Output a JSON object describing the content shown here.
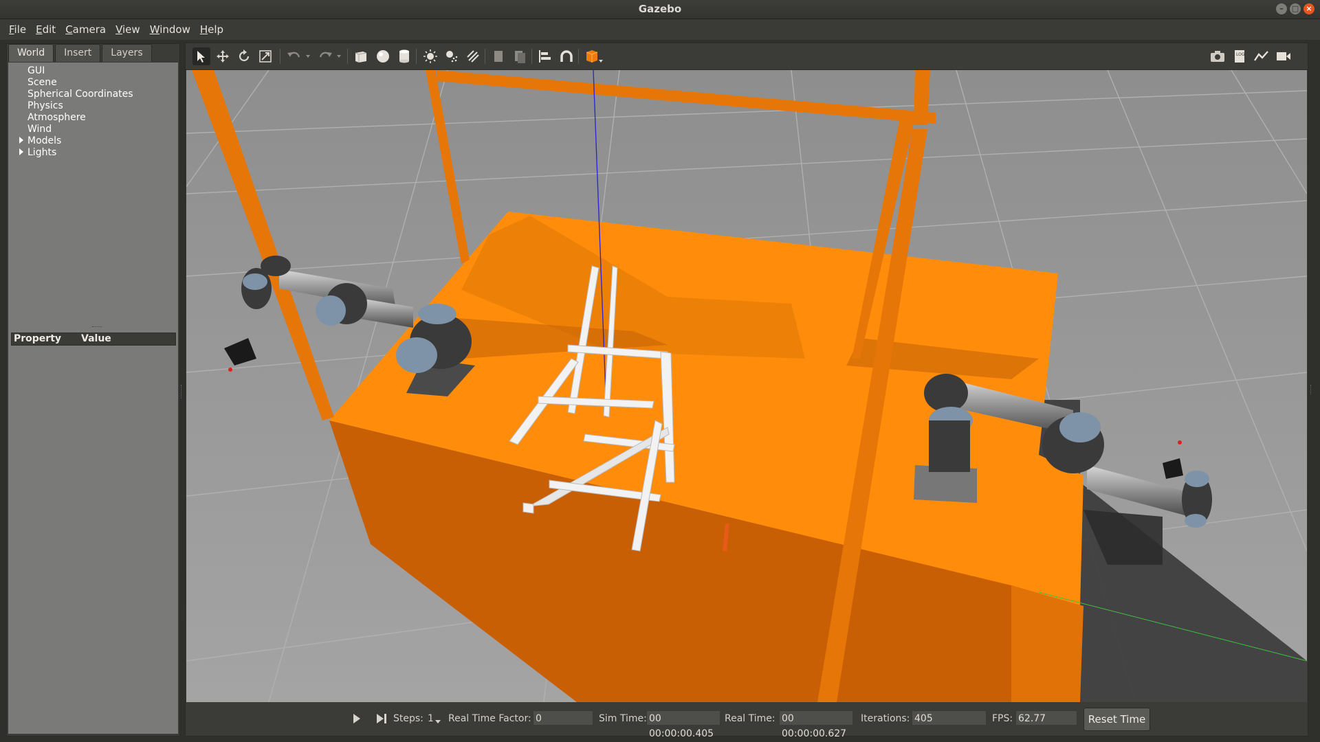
{
  "window": {
    "title": "Gazebo"
  },
  "menu": [
    {
      "key": "F",
      "rest": "ile"
    },
    {
      "key": "E",
      "rest": "dit"
    },
    {
      "key": "C",
      "rest": "amera"
    },
    {
      "key": "V",
      "rest": "iew"
    },
    {
      "key": "W",
      "rest": "indow"
    },
    {
      "key": "H",
      "rest": "elp"
    }
  ],
  "tabs": [
    "World",
    "Insert",
    "Layers"
  ],
  "tree": [
    "GUI",
    "Scene",
    "Spherical Coordinates",
    "Physics",
    "Atmosphere",
    "Wind",
    "Models",
    "Lights"
  ],
  "properties": {
    "col1": "Property",
    "col2": "Value"
  },
  "bottom": {
    "steps_label": "Steps:",
    "steps_value": "1",
    "rtf_label": "Real Time Factor:",
    "rtf_value": "0",
    "sim_label": "Sim Time:",
    "sim_value": "00 00:00:00.405",
    "real_label": "Real Time:",
    "real_value": "00 00:00:00.627",
    "iter_label": "Iterations:",
    "iter_value": "405",
    "fps_label": "FPS:",
    "fps_value": "62.77",
    "reset_label": "Reset Time"
  },
  "colors": {
    "accent_orange": "#ff8c0a",
    "ground": "#9a9a9a"
  },
  "icons": [
    "select-icon",
    "translate-icon",
    "rotate-icon",
    "scale-icon",
    "undo-icon",
    "redo-icon",
    "box-icon",
    "sphere-icon",
    "cylinder-icon",
    "point-light-icon",
    "spot-light-icon",
    "directional-light-icon",
    "copy-icon",
    "paste-icon",
    "align-icon",
    "snap-icon",
    "view-angle-icon",
    "screenshot-icon",
    "log-icon",
    "plot-icon",
    "record-icon"
  ]
}
